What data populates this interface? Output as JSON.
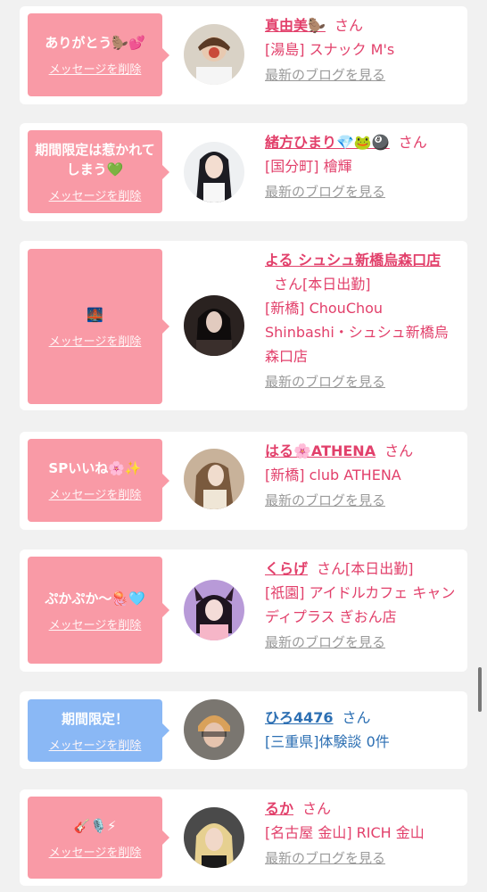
{
  "delete_label": "メッセージを削除",
  "blog_label": "最新のブログを見る",
  "san_label": "さん",
  "items": [
    {
      "message": "ありがとう🦫💕",
      "name": "真由美🦫",
      "status": "",
      "shop": "[湯島] スナック M's"
    },
    {
      "message": "期間限定は惹かれてしまう💚",
      "name": "緒方ひまり💎🐸🎱",
      "status": "",
      "shop": "[国分町] 檜輝"
    },
    {
      "message": "🌉",
      "name": "よる シュシュ新橋烏森口店",
      "status": "[本日出勤]",
      "shop": "[新橋] ChouChou Shinbashi・シュシュ新橋烏森口店"
    },
    {
      "message": "SPいいね🌸✨",
      "name": "はる🌸ATHENA",
      "status": "",
      "shop": "[新橋] club ATHENA"
    },
    {
      "message": "ぷかぷか〜🪼🩵",
      "name": "くらげ",
      "status": "[本日出勤]",
      "shop": "[祇園] アイドルカフェ キャンディプラス ぎおん店"
    },
    {
      "message": "期間限定！",
      "name": "ひろ4476",
      "status": "",
      "shop": "[三重県]体験談 0件"
    },
    {
      "message": "🎸🎙️⚡",
      "name": "るか",
      "status": "",
      "shop": "[名古屋 金山] RICH 金山"
    }
  ],
  "colors": {
    "pink_bubble": "#f99aa6",
    "blue_bubble": "#8ab8f5",
    "pink_text": "#e2406b",
    "blue_text": "#2c6fb3"
  }
}
